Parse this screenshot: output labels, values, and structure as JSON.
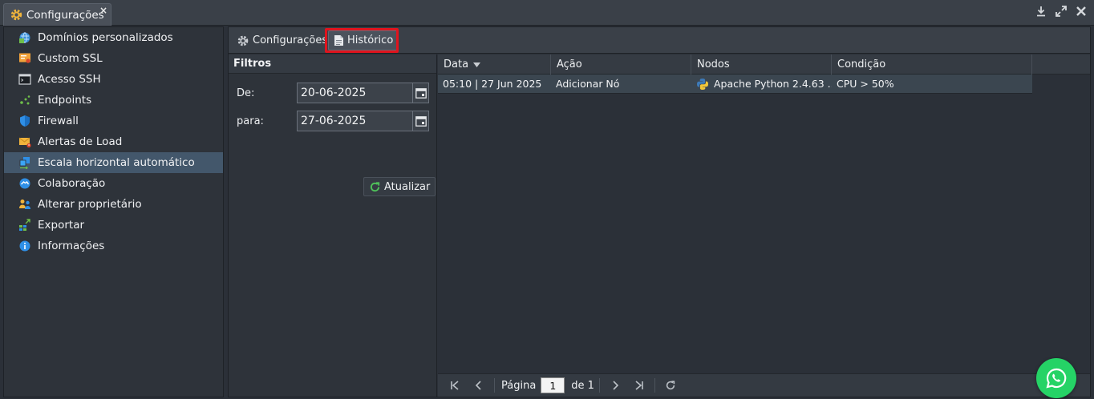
{
  "window": {
    "tab_label": "Configurações",
    "close_glyph": "×",
    "controls": [
      "download-icon",
      "expand-icon",
      "close-icon"
    ]
  },
  "sidebar": {
    "items": [
      {
        "label": "Domínios personalizados",
        "icon": "domain-icon"
      },
      {
        "label": "Custom SSL",
        "icon": "ssl-certificate-icon"
      },
      {
        "label": "Acesso SSH",
        "icon": "terminal-icon"
      },
      {
        "label": "Endpoints",
        "icon": "endpoints-icon"
      },
      {
        "label": "Firewall",
        "icon": "shield-icon"
      },
      {
        "label": "Alertas de Load",
        "icon": "alert-envelope-icon"
      },
      {
        "label": "Escala horizontal automático",
        "icon": "scaling-icon",
        "active": true
      },
      {
        "label": "Colaboração",
        "icon": "handshake-icon"
      },
      {
        "label": "Alterar proprietário",
        "icon": "users-icon"
      },
      {
        "label": "Exportar",
        "icon": "export-icon"
      },
      {
        "label": "Informações",
        "icon": "info-icon"
      }
    ]
  },
  "toolbar": {
    "config_label": "Configurações",
    "history_label": "Histórico"
  },
  "filters": {
    "title": "Filtros",
    "from_label": "De:",
    "from_value": "20-06-2025",
    "to_label": "para:",
    "to_value": "27-06-2025",
    "refresh_label": "Atualizar"
  },
  "grid": {
    "columns": [
      "Data",
      "Ação",
      "Nodos",
      "Condição"
    ],
    "rows": [
      {
        "date": "05:10 | 27 Jun 2025",
        "action": "Adicionar Nó",
        "node": "Apache Python 2.4.63 ...",
        "condition": "CPU > 50%"
      }
    ]
  },
  "pager": {
    "page_label": "Página",
    "page_value": "1",
    "of_label": "de 1"
  },
  "colors": {
    "accent_active": "#43576b",
    "highlight": "#e0141e",
    "whatsapp": "#25d366"
  }
}
